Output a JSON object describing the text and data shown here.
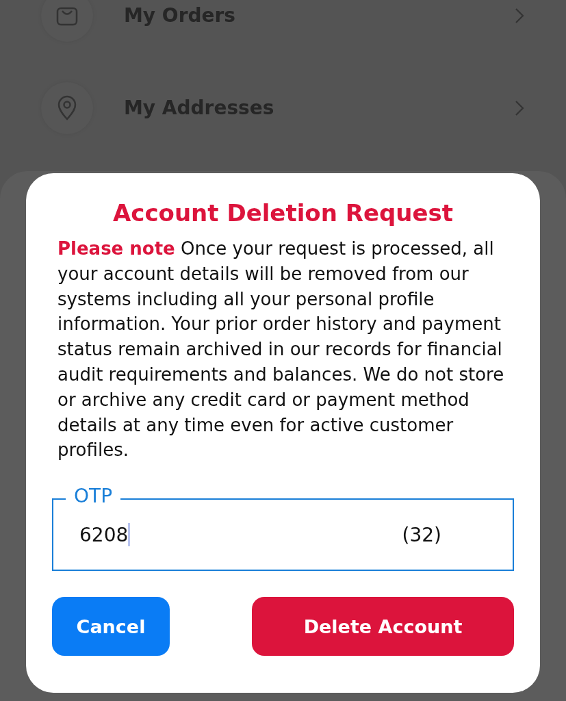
{
  "background": {
    "menu_items": [
      {
        "label": "My Orders"
      },
      {
        "label": "My Addresses"
      }
    ]
  },
  "dialog": {
    "title": "Account Deletion Request",
    "message": "**Please note** Once your request is processed, all your account details will be removed from our systems including all your personal profile information. Your prior order history and payment status remain archived in our records for financial audit requirements and balances. We do not store or archive any credit card or payment method details at any time even for active customer profiles.",
    "otp_field": {
      "label": "OTP",
      "value": "6208",
      "countdown": "(32)"
    },
    "buttons": [
      {
        "label": "Cancel",
        "kind": "secondary"
      },
      {
        "label": "Delete Account",
        "kind": "danger"
      }
    ]
  }
}
